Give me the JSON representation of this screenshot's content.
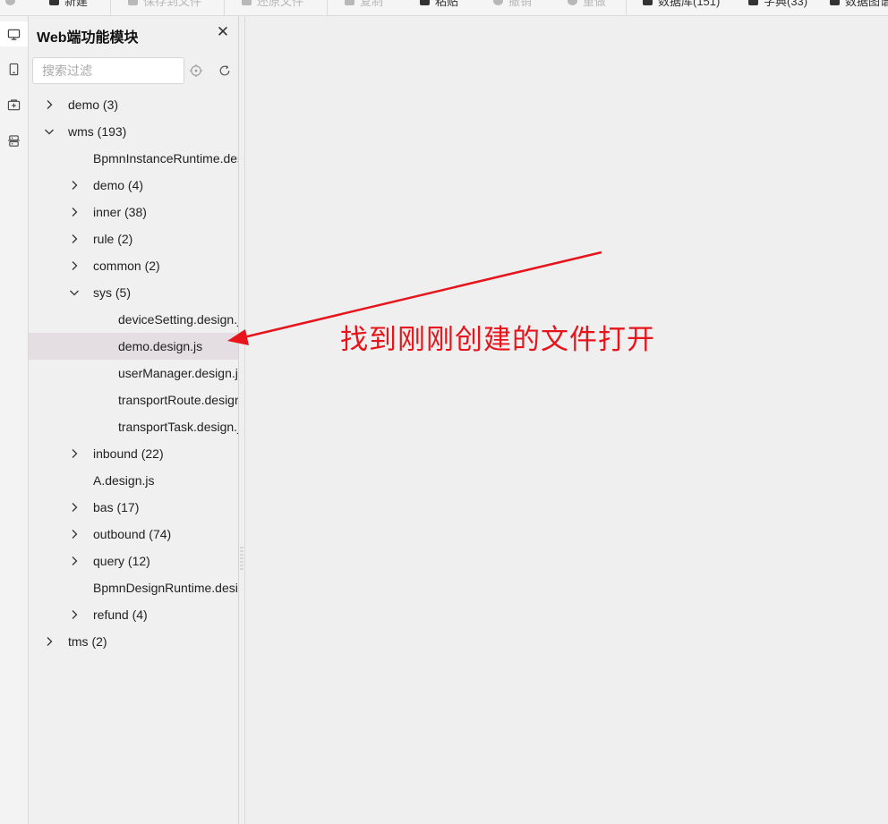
{
  "toolbar": {
    "items": [
      {
        "label": "新建",
        "icon": "new-icon",
        "disabled": false
      },
      {
        "label": "保存到文件",
        "icon": "save-icon",
        "disabled": true
      },
      {
        "label": "还原文件",
        "icon": "restore-icon",
        "disabled": true
      },
      {
        "label": "复制",
        "icon": "copy-icon",
        "disabled": true
      },
      {
        "label": "粘贴",
        "icon": "paste-icon",
        "disabled": false
      },
      {
        "label": "撤销",
        "icon": "undo-icon",
        "disabled": true
      },
      {
        "label": "重做",
        "icon": "redo-icon",
        "disabled": true
      },
      {
        "label": "数据库(151)",
        "icon": "database-icon",
        "disabled": false
      },
      {
        "label": "字典(33)",
        "icon": "dictionary-icon",
        "disabled": false
      },
      {
        "label": "数据图谱",
        "icon": "data-graph-icon",
        "disabled": false
      }
    ]
  },
  "activity_bar": {
    "items": [
      "desktop-icon",
      "mobile-icon",
      "add-module-icon",
      "service-icon"
    ]
  },
  "panel": {
    "title": "Web端功能模块",
    "search_placeholder": "搜索过滤"
  },
  "tree": [
    {
      "label": "demo (3)",
      "level": 0,
      "type": "folder",
      "expanded": false
    },
    {
      "label": "wms (193)",
      "level": 0,
      "type": "folder",
      "expanded": true
    },
    {
      "label": "BpmnInstanceRuntime.design.js",
      "level": 1,
      "type": "file"
    },
    {
      "label": "demo (4)",
      "level": 1,
      "type": "folder",
      "expanded": false
    },
    {
      "label": "inner (38)",
      "level": 1,
      "type": "folder",
      "expanded": false
    },
    {
      "label": "rule (2)",
      "level": 1,
      "type": "folder",
      "expanded": false
    },
    {
      "label": "common (2)",
      "level": 1,
      "type": "folder",
      "expanded": false
    },
    {
      "label": "sys (5)",
      "level": 1,
      "type": "folder",
      "expanded": true
    },
    {
      "label": "deviceSetting.design.js",
      "level": 2,
      "type": "file"
    },
    {
      "label": "demo.design.js",
      "level": 2,
      "type": "file",
      "selected": true
    },
    {
      "label": "userManager.design.js",
      "level": 2,
      "type": "file"
    },
    {
      "label": "transportRoute.design.js",
      "level": 2,
      "type": "file"
    },
    {
      "label": "transportTask.design.js",
      "level": 2,
      "type": "file"
    },
    {
      "label": "inbound (22)",
      "level": 1,
      "type": "folder",
      "expanded": false
    },
    {
      "label": "A.design.js",
      "level": 1,
      "type": "file"
    },
    {
      "label": "bas (17)",
      "level": 1,
      "type": "folder",
      "expanded": false
    },
    {
      "label": "outbound (74)",
      "level": 1,
      "type": "folder",
      "expanded": false
    },
    {
      "label": "query (12)",
      "level": 1,
      "type": "folder",
      "expanded": false
    },
    {
      "label": "BpmnDesignRuntime.design.js",
      "level": 1,
      "type": "file"
    },
    {
      "label": "refund (4)",
      "level": 1,
      "type": "folder",
      "expanded": false
    },
    {
      "label": "tms (2)",
      "level": 0,
      "type": "folder",
      "expanded": false
    }
  ],
  "annotation": {
    "text": "找到刚刚创建的文件打开",
    "color": "#e8141b"
  },
  "colors": {
    "selected_row": "#e4dde2",
    "background": "#efefef"
  }
}
